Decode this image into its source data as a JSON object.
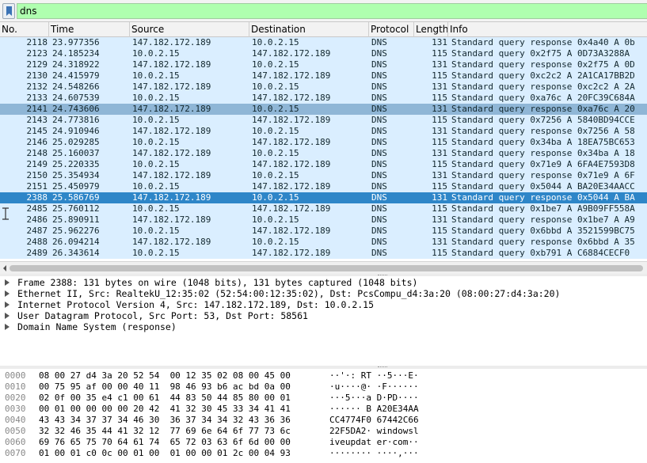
{
  "filter": {
    "value": "dns"
  },
  "columns": [
    "No.",
    "Time",
    "Source",
    "Destination",
    "Protocol",
    "Length",
    "Info"
  ],
  "packets": [
    {
      "no": "2118",
      "time": "23.977356",
      "src": "147.182.172.189",
      "dst": "10.0.2.15",
      "proto": "DNS",
      "len": "131",
      "info": "Standard query response 0x4a40 A 0b",
      "state": "normal"
    },
    {
      "no": "2123",
      "time": "24.185234",
      "src": "10.0.2.15",
      "dst": "147.182.172.189",
      "proto": "DNS",
      "len": "115",
      "info": "Standard query 0x2f75 A 0D73A3288A",
      "state": "normal"
    },
    {
      "no": "2129",
      "time": "24.318922",
      "src": "147.182.172.189",
      "dst": "10.0.2.15",
      "proto": "DNS",
      "len": "131",
      "info": "Standard query response 0x2f75 A 0D",
      "state": "normal"
    },
    {
      "no": "2130",
      "time": "24.415979",
      "src": "10.0.2.15",
      "dst": "147.182.172.189",
      "proto": "DNS",
      "len": "115",
      "info": "Standard query 0xc2c2 A 2A1CA17BB2D",
      "state": "normal"
    },
    {
      "no": "2132",
      "time": "24.548266",
      "src": "147.182.172.189",
      "dst": "10.0.2.15",
      "proto": "DNS",
      "len": "131",
      "info": "Standard query response 0xc2c2 A 2A",
      "state": "normal"
    },
    {
      "no": "2133",
      "time": "24.607539",
      "src": "10.0.2.15",
      "dst": "147.182.172.189",
      "proto": "DNS",
      "len": "115",
      "info": "Standard query 0xa76c A 20FC39C684A",
      "state": "normal"
    },
    {
      "no": "2141",
      "time": "24.743606",
      "src": "147.182.172.189",
      "dst": "10.0.2.15",
      "proto": "DNS",
      "len": "131",
      "info": "Standard query response 0xa76c A 20",
      "state": "marked"
    },
    {
      "no": "2143",
      "time": "24.773816",
      "src": "10.0.2.15",
      "dst": "147.182.172.189",
      "proto": "DNS",
      "len": "115",
      "info": "Standard query 0x7256 A 5840BD94CCE",
      "state": "normal"
    },
    {
      "no": "2145",
      "time": "24.910946",
      "src": "147.182.172.189",
      "dst": "10.0.2.15",
      "proto": "DNS",
      "len": "131",
      "info": "Standard query response 0x7256 A 58",
      "state": "normal"
    },
    {
      "no": "2146",
      "time": "25.029285",
      "src": "10.0.2.15",
      "dst": "147.182.172.189",
      "proto": "DNS",
      "len": "115",
      "info": "Standard query 0x34ba A 18EA75BC653",
      "state": "normal"
    },
    {
      "no": "2148",
      "time": "25.160037",
      "src": "147.182.172.189",
      "dst": "10.0.2.15",
      "proto": "DNS",
      "len": "131",
      "info": "Standard query response 0x34ba A 18",
      "state": "normal"
    },
    {
      "no": "2149",
      "time": "25.220335",
      "src": "10.0.2.15",
      "dst": "147.182.172.189",
      "proto": "DNS",
      "len": "115",
      "info": "Standard query 0x71e9 A 6FA4E7593D8",
      "state": "normal"
    },
    {
      "no": "2150",
      "time": "25.354934",
      "src": "147.182.172.189",
      "dst": "10.0.2.15",
      "proto": "DNS",
      "len": "131",
      "info": "Standard query response 0x71e9 A 6F",
      "state": "normal"
    },
    {
      "no": "2151",
      "time": "25.450979",
      "src": "10.0.2.15",
      "dst": "147.182.172.189",
      "proto": "DNS",
      "len": "115",
      "info": "Standard query 0x5044 A BA20E34AACC",
      "state": "normal"
    },
    {
      "no": "2388",
      "time": "25.586769",
      "src": "147.182.172.189",
      "dst": "10.0.2.15",
      "proto": "DNS",
      "len": "131",
      "info": "Standard query response 0x5044 A BA",
      "state": "selected"
    },
    {
      "no": "2485",
      "time": "25.760112",
      "src": "10.0.2.15",
      "dst": "147.182.172.189",
      "proto": "DNS",
      "len": "115",
      "info": "Standard query 0x1be7 A A9B09FF558A",
      "state": "normal"
    },
    {
      "no": "2486",
      "time": "25.890911",
      "src": "147.182.172.189",
      "dst": "10.0.2.15",
      "proto": "DNS",
      "len": "131",
      "info": "Standard query response 0x1be7 A A9",
      "state": "normal"
    },
    {
      "no": "2487",
      "time": "25.962276",
      "src": "10.0.2.15",
      "dst": "147.182.172.189",
      "proto": "DNS",
      "len": "115",
      "info": "Standard query 0x6bbd A 3521599BC75",
      "state": "normal"
    },
    {
      "no": "2488",
      "time": "26.094214",
      "src": "147.182.172.189",
      "dst": "10.0.2.15",
      "proto": "DNS",
      "len": "131",
      "info": "Standard query response 0x6bbd A 35",
      "state": "normal"
    },
    {
      "no": "2489",
      "time": "26.343614",
      "src": "10.0.2.15",
      "dst": "147.182.172.189",
      "proto": "DNS",
      "len": "115",
      "info": "Standard query 0xb791 A C6884CECF0",
      "state": "normal"
    }
  ],
  "details": [
    "Frame 2388: 131 bytes on wire (1048 bits), 131 bytes captured (1048 bits)",
    "Ethernet II, Src: RealtekU_12:35:02 (52:54:00:12:35:02), Dst: PcsCompu_d4:3a:20 (08:00:27:d4:3a:20)",
    "Internet Protocol Version 4, Src: 147.182.172.189, Dst: 10.0.2.15",
    "User Datagram Protocol, Src Port: 53, Dst Port: 58561",
    "Domain Name System (response)"
  ],
  "hexdump": [
    {
      "offset": "0000",
      "hex": "08 00 27 d4 3a 20 52 54  00 12 35 02 08 00 45 00",
      "ascii": "··'·: RT ··5···E·"
    },
    {
      "offset": "0010",
      "hex": "00 75 95 af 00 00 40 11  98 46 93 b6 ac bd 0a 00",
      "ascii": "·u····@· ·F······"
    },
    {
      "offset": "0020",
      "hex": "02 0f 00 35 e4 c1 00 61  44 83 50 44 85 80 00 01",
      "ascii": "···5···a D·PD····"
    },
    {
      "offset": "0030",
      "hex": "00 01 00 00 00 00 20 42  41 32 30 45 33 34 41 41",
      "ascii": "······ B A20E34AA"
    },
    {
      "offset": "0040",
      "hex": "43 43 34 37 37 34 46 30  36 37 34 34 32 43 36 36",
      "ascii": "CC4774F0 67442C66"
    },
    {
      "offset": "0050",
      "hex": "32 32 46 35 44 41 32 12  77 69 6e 64 6f 77 73 6c",
      "ascii": "22F5DA2· windowsl"
    },
    {
      "offset": "0060",
      "hex": "69 76 65 75 70 64 61 74  65 72 03 63 6f 6d 00 00",
      "ascii": "iveupdat er·com··"
    },
    {
      "offset": "0070",
      "hex": "01 00 01 c0 0c 00 01 00  01 00 00 01 2c 00 04 93",
      "ascii": "········ ····,···"
    }
  ]
}
